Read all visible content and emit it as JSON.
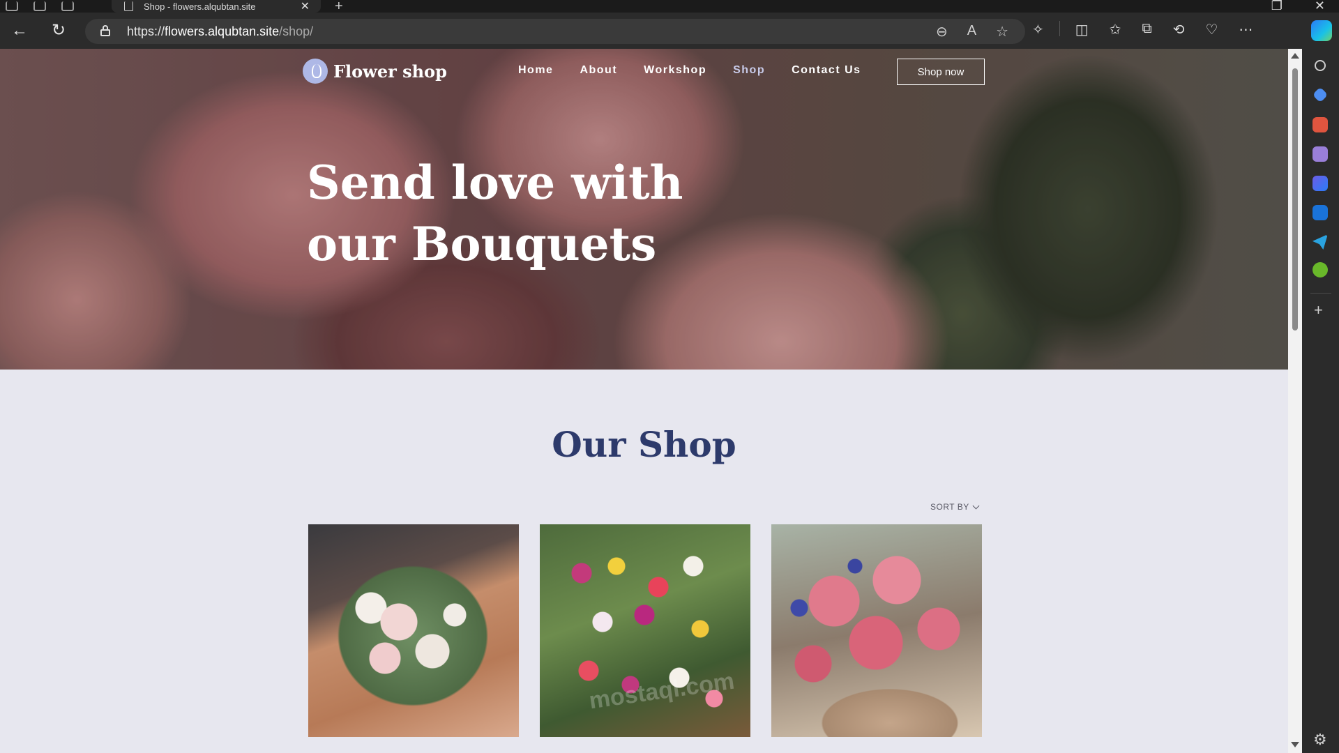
{
  "browser": {
    "tab_title": "Shop - flowers.alqubtan.site",
    "url_scheme": "https://",
    "url_host": "flowers.alqubtan.site",
    "url_path": "/shop/",
    "tab_close_glyph": "✕",
    "new_tab_glyph": "+",
    "toolbar_icons": [
      "zoom-icon",
      "read-aloud-icon",
      "favorite-star-icon",
      "extensions-icon",
      "split-screen-icon",
      "favorites-icon",
      "collections-icon",
      "history-icon",
      "browser-essentials-icon",
      "more-icon"
    ],
    "sidebar_icons": [
      "search-icon",
      "shopping-icon",
      "tools-icon",
      "games-icon",
      "m365-icon",
      "outlook-icon",
      "telegram-icon",
      "tree-icon",
      "add-icon",
      "settings-icon"
    ]
  },
  "site": {
    "logo_text": "Flower shop",
    "nav": [
      {
        "label": "Home",
        "active": false
      },
      {
        "label": "About",
        "active": false
      },
      {
        "label": "Workshop",
        "active": false
      },
      {
        "label": "Shop",
        "active": true
      },
      {
        "label": "Contact Us",
        "active": false
      }
    ],
    "cta_label": "Shop now",
    "hero_line1": "Send love with",
    "hero_line2": "our Bouquets",
    "section_title": "Our Shop",
    "sort_label": "SORT BY",
    "watermark": "mostaql.com"
  },
  "colors": {
    "accent": "#2d3a6b",
    "active_nav": "#c8cbe9",
    "page_bg": "#e7e7ef"
  }
}
